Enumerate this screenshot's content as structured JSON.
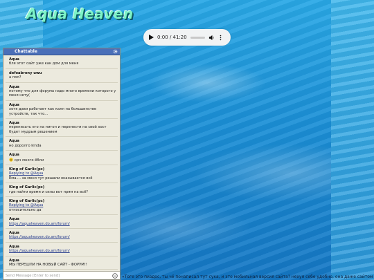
{
  "site": {
    "logo_text": "Aqua Heaven"
  },
  "player": {
    "time": "0:00 / 41:20",
    "progress": 0
  },
  "chat": {
    "title": "Chattable",
    "input_placeholder": "Send Message [Enter to send]",
    "messages": [
      {
        "author": "Aqua",
        "quote": "",
        "text": "бля этот сайт уже как дом для меня",
        "link": ""
      },
      {
        "author": "defoabrony uwu",
        "quote": "",
        "text": "а пол?",
        "link": ""
      },
      {
        "author": "Aqua",
        "quote": "",
        "text": "потому что для форума надо много времени которого у меня нету(",
        "link": ""
      },
      {
        "author": "Aqua",
        "quote": "",
        "text": "хотя дави работает как калл на большинстве устройств, так что...",
        "link": ""
      },
      {
        "author": "Aqua",
        "quote": "",
        "text": "переписать его на питон и перенести на свой хост будет мудрым решением",
        "link": ""
      },
      {
        "author": "Aqua",
        "quote": "",
        "text": "но доролго kinda",
        "link": ""
      },
      {
        "author": "Aqua",
        "quote": "",
        "text": "крч много ёбли",
        "link": "",
        "emoji": true
      },
      {
        "author": "King of Garlic(pc)",
        "quote": "Replying to @Aqua",
        "text": "Ема.... за меня тут решали оказывается всё",
        "link": ""
      },
      {
        "author": "King of Garlic(pc)",
        "quote": "",
        "text": "где найти время и силы вот прям на всё?",
        "link": ""
      },
      {
        "author": "King of Garlic(pc)",
        "quote": "Replying to @Aqua",
        "text": "относительно да",
        "link": ""
      },
      {
        "author": "Aqua",
        "quote": "",
        "text": "",
        "link": "https://aquaheaven.do.am/forum/"
      },
      {
        "author": "Aqua",
        "quote": "",
        "text": "",
        "link": "https://aquaheaven.do.am/forum/"
      },
      {
        "author": "Aqua",
        "quote": "",
        "text": "",
        "link": "https://aquaheaven.do.am/forum/"
      },
      {
        "author": "Aqua",
        "quote": "",
        "text": "МЫ ПЕРЕШЛИ НА НОВЫЙ САЙТ - ФОРУМ!!",
        "link": ""
      }
    ]
  },
  "marquee": {
    "text": "«Тоге это пиздос, ты чё понаписал тут сука, и это мобильная версия сайта? нехуя себе удобно, она даже сайтом"
  },
  "colors": {
    "chat_header": "#4a6fb8",
    "chat_bg": "#eceade",
    "logo": "#7ef2c8"
  },
  "icons": {
    "play": "play-icon",
    "volume": "volume-icon",
    "more": "more-vert-icon",
    "settings": "gear-icon",
    "emoji": "smile-icon"
  }
}
